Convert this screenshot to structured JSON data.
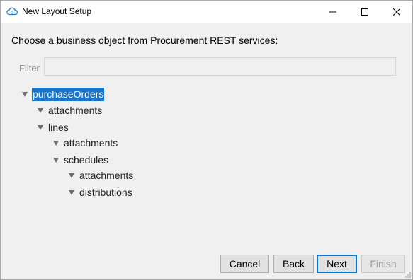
{
  "window": {
    "title": "New Layout Setup"
  },
  "dialog": {
    "prompt": "Choose a business object from Procurement REST services:"
  },
  "filter": {
    "label": "Filter",
    "value": "",
    "placeholder": ""
  },
  "tree": {
    "nodes": [
      {
        "label": "purchaseOrders",
        "level": 0,
        "selected": true,
        "expanded": true
      },
      {
        "label": "attachments",
        "level": 1,
        "selected": false,
        "expanded": true
      },
      {
        "label": "lines",
        "level": 1,
        "selected": false,
        "expanded": true
      },
      {
        "label": "attachments",
        "level": 2,
        "selected": false,
        "expanded": true
      },
      {
        "label": "schedules",
        "level": 2,
        "selected": false,
        "expanded": true
      },
      {
        "label": "attachments",
        "level": 3,
        "selected": false,
        "expanded": true
      },
      {
        "label": "distributions",
        "level": 3,
        "selected": false,
        "expanded": true
      }
    ]
  },
  "buttons": {
    "cancel": "Cancel",
    "back": "Back",
    "next": "Next",
    "finish": "Finish"
  },
  "colors": {
    "selection": "#1a74c9",
    "default_button_border": "#0078d7"
  },
  "icons": {
    "app": "cloud-settings-icon",
    "minimize": "minimize-icon",
    "maximize": "maximize-icon",
    "close": "close-icon",
    "expand": "triangle-down-icon",
    "resize": "resize-grip-icon"
  }
}
